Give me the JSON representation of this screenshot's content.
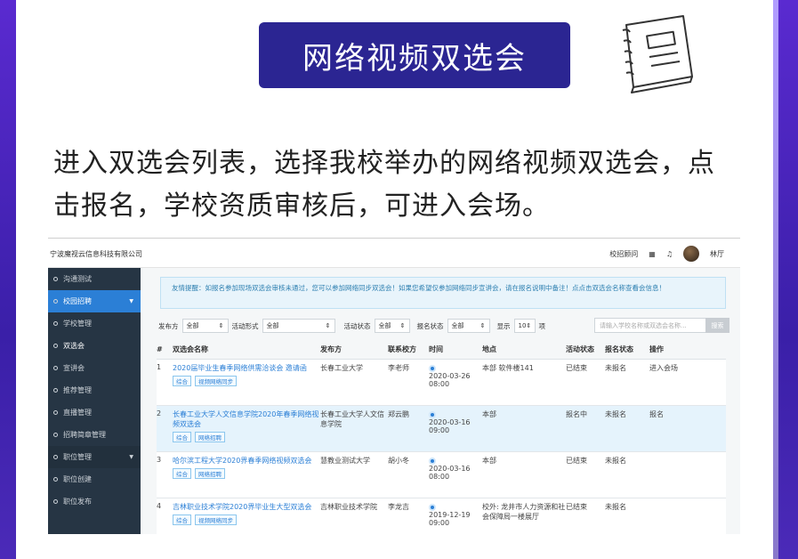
{
  "slide": {
    "title": "网络视频双选会",
    "instruction": "进入双选会列表，选择我校举办的网络视频双选会，点击报名，学校资质审核后，可进入会场。"
  },
  "app": {
    "company": "宁波魔视云信息科技有限公司",
    "top_links": [
      "校招顾问",
      "网",
      "铃"
    ],
    "user_name": "林厅",
    "sidebar": [
      {
        "label": "沟通测试",
        "type": "item"
      },
      {
        "label": "校园招聘",
        "type": "active-section"
      },
      {
        "label": "学校管理",
        "type": "item"
      },
      {
        "label": "双选会",
        "type": "item"
      },
      {
        "label": "宣讲会",
        "type": "item"
      },
      {
        "label": "推荐管理",
        "type": "item"
      },
      {
        "label": "直播管理",
        "type": "item"
      },
      {
        "label": "招聘简章管理",
        "type": "item"
      },
      {
        "label": "职位管理",
        "type": "section"
      },
      {
        "label": "职位创建",
        "type": "item"
      },
      {
        "label": "职位发布",
        "type": "item"
      }
    ],
    "notice": "友情提醒：如报名参加现场双选会审核未通过，您可以参加网络同步双选会！如果您希望仅参加网络同步宣讲会，请在报名说明中备注！点点击双选会名称查看会信息！",
    "filters": {
      "publisher_label": "发布方",
      "publisher_value": "全部",
      "form_label": "活动形式",
      "form_value": "全部",
      "status_label": "活动状态",
      "status_value": "全部",
      "signup_label": "报名状态",
      "signup_value": "全部",
      "show_label": "显示",
      "show_value": "10",
      "show_unit": "项",
      "search_placeholder": "请输入学校名称或双选会名称...",
      "search_button": "搜索"
    },
    "table": {
      "headers": [
        "#",
        "双选会名称",
        "发布方",
        "联系校方",
        "时间",
        "地点",
        "活动状态",
        "报名状态",
        "操作"
      ],
      "rows": [
        {
          "num": "1",
          "name": "2020届毕业生春季网络供需洽谈会 邀请函",
          "tags": [
            "综合",
            "视频网络同步"
          ],
          "publisher": "长春工业大学",
          "contact": "李老师",
          "date": "2020-03-26",
          "time": "08:00",
          "place": "本部 软件楼141",
          "status": "已结束",
          "signup": "未报名",
          "action": "进入会场"
        },
        {
          "num": "2",
          "name": "长春工业大学人文信息学院2020年春季网络视频双选会",
          "tags": [
            "综合",
            "网络招聘"
          ],
          "publisher": "长春工业大学人文信息学院",
          "contact": "郑云鹏",
          "date": "2020-03-16",
          "time": "09:00",
          "place": "本部",
          "status": "报名中",
          "signup": "未报名",
          "action": "报名"
        },
        {
          "num": "3",
          "name": "哈尔滨工程大学2020界春季网络视频双选会",
          "tags": [
            "综合",
            "网络招聘"
          ],
          "publisher": "慧教业测试大学",
          "contact": "胡小冬",
          "date": "2020-03-16",
          "time": "08:00",
          "place": "本部",
          "status": "已结束",
          "signup": "未报名",
          "action": ""
        },
        {
          "num": "4",
          "name": "吉林职业技术学院2020界毕业生大型双选会",
          "tags": [
            "综合",
            "视频网络同步"
          ],
          "publisher": "吉林职业技术学院",
          "contact": "李龙吉",
          "date": "2019-12-19",
          "time": "09:00",
          "place": "校外: 龙井市人力资源和社会保障局一楼展厅",
          "status": "已结束",
          "signup": "未报名",
          "action": ""
        }
      ]
    }
  }
}
